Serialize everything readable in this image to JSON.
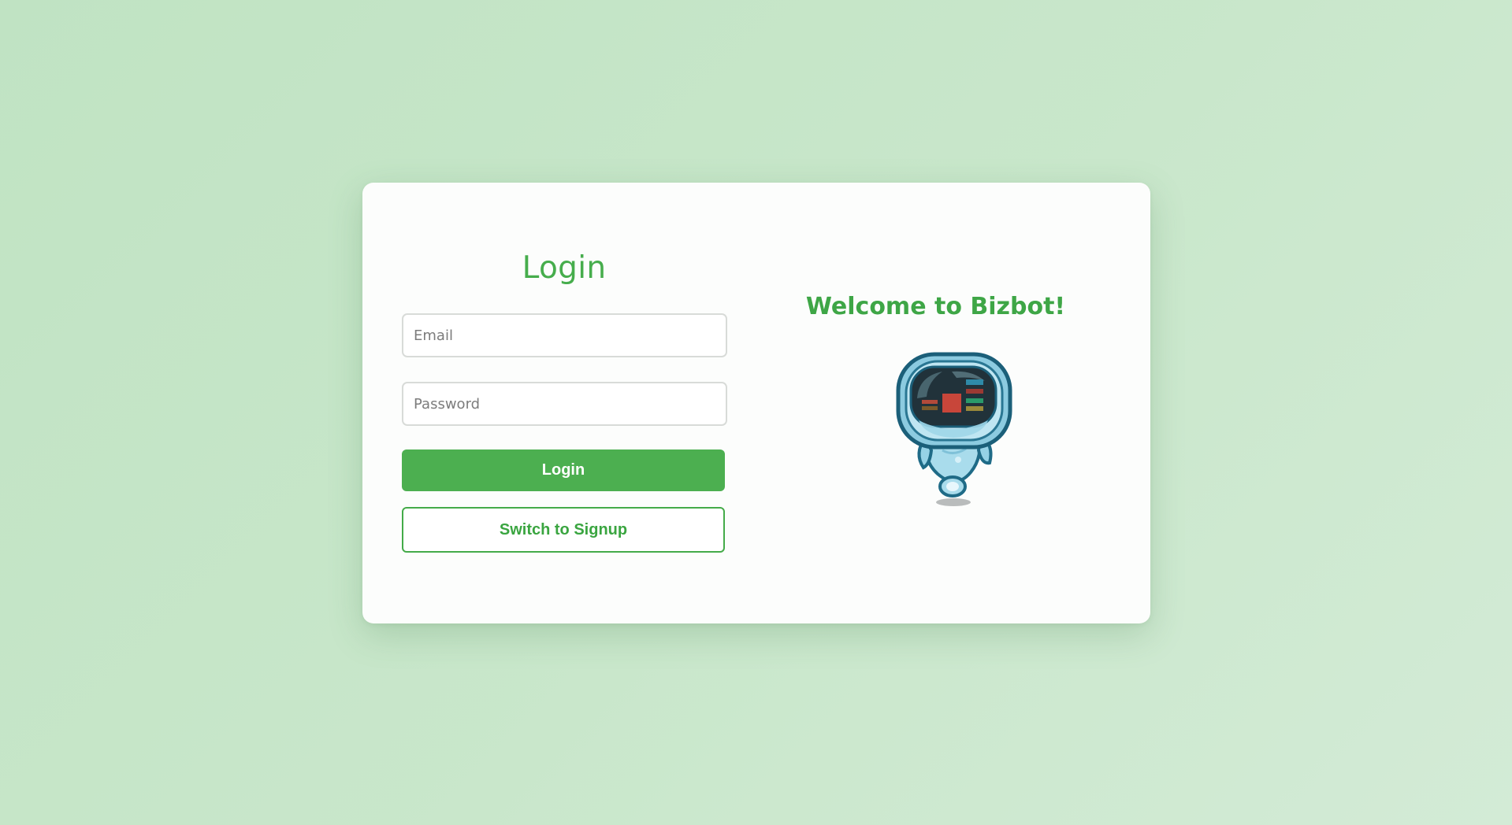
{
  "login": {
    "title": "Login",
    "email_placeholder": "Email",
    "password_placeholder": "Password",
    "login_button": "Login",
    "switch_button": "Switch to Signup"
  },
  "welcome": {
    "heading": "Welcome to Bizbot!",
    "mascot_icon": "robot-mascot-icon"
  },
  "colors": {
    "primary": "#4caf50",
    "heading": "#46ad4c",
    "background": "#c4e5c7"
  }
}
